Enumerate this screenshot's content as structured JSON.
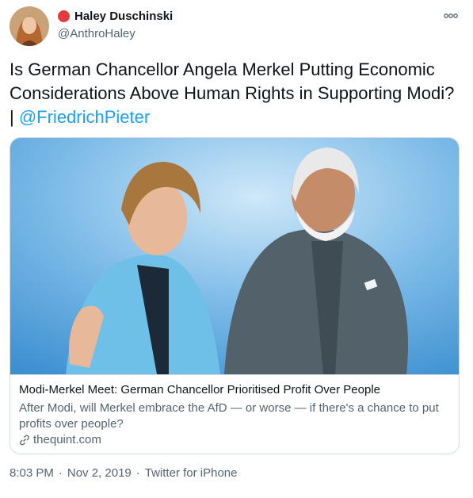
{
  "user": {
    "display_name": "Haley Duschinski",
    "handle": "@AnthroHaley",
    "avatar_icon": "profile-photo",
    "badge_icon": "red-circle-emoji"
  },
  "tweet": {
    "text": "Is German Chancellor Angela Merkel Putting Economic Considerations Above Human Rights in Supporting Modi? | ",
    "mention": "@FriedrichPieter",
    "more_icon": "more-options-icon"
  },
  "card": {
    "title": "Modi-Merkel Meet: German Chancellor Prioritised Profit Over People",
    "description": "After Modi, will Merkel embrace the AfD — or worse — if there's a chance to put profits over people?",
    "domain": "thequint.com",
    "link_icon": "link-icon"
  },
  "meta": {
    "time": "8:03 PM",
    "separator": "·",
    "date": "Nov 2, 2019",
    "source": "Twitter for iPhone"
  },
  "colors": {
    "link": "#1da1f2",
    "secondary_text": "#536471",
    "border": "#cfd9de",
    "image_bg": "#5fa9dd"
  }
}
